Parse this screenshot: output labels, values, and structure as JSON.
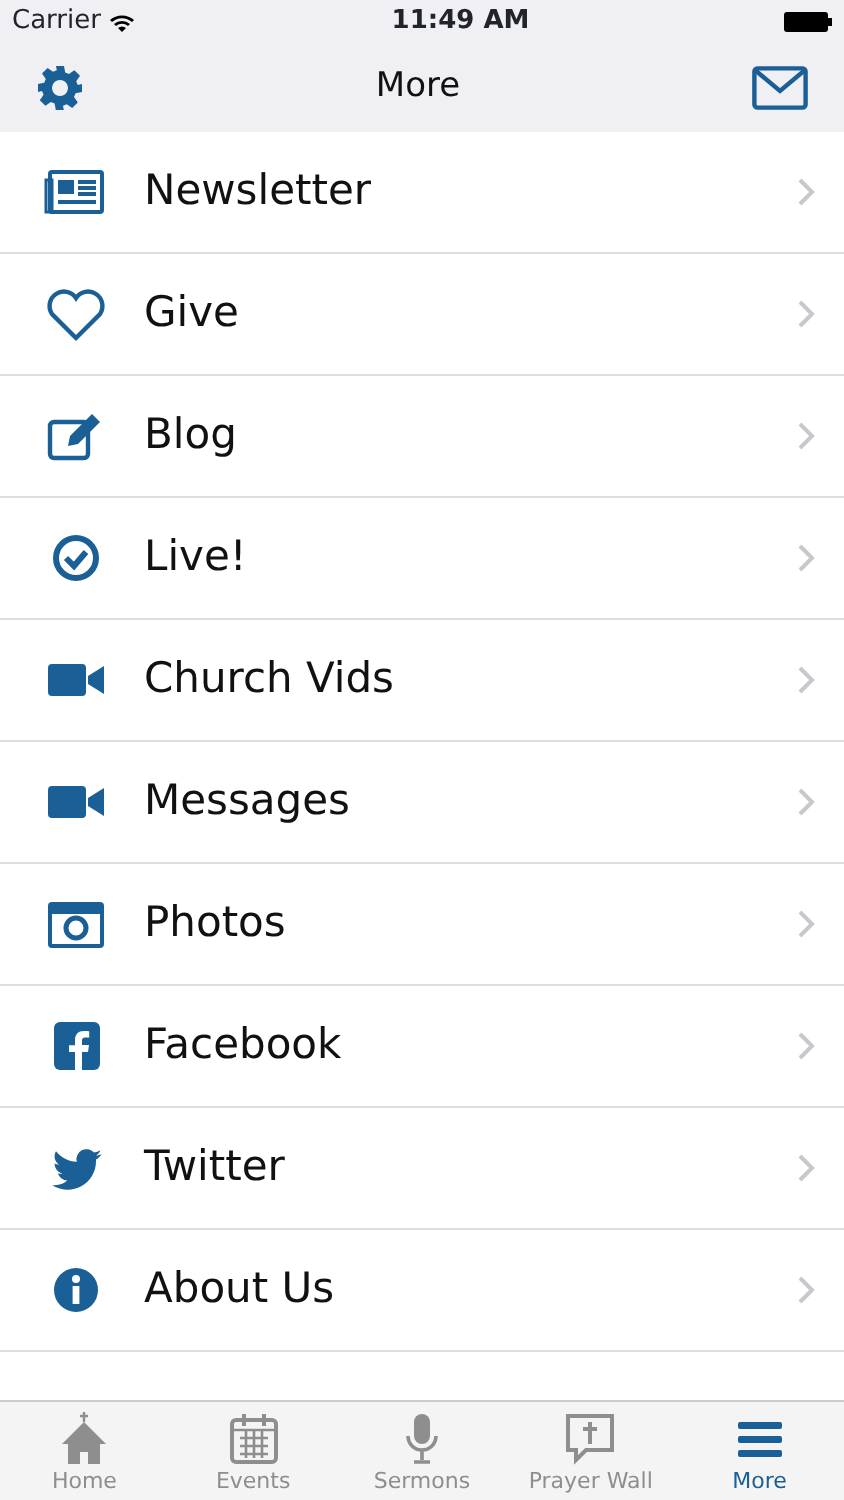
{
  "status_bar": {
    "carrier": "Carrier",
    "time": "11:49 AM"
  },
  "nav_bar": {
    "title": "More"
  },
  "items": [
    {
      "label": "Newsletter"
    },
    {
      "label": "Give"
    },
    {
      "label": "Blog"
    },
    {
      "label": "Live!"
    },
    {
      "label": "Church Vids"
    },
    {
      "label": "Messages"
    },
    {
      "label": "Photos"
    },
    {
      "label": "Facebook"
    },
    {
      "label": "Twitter"
    },
    {
      "label": "About Us"
    }
  ],
  "tab_bar": [
    {
      "label": "Home",
      "selected": false
    },
    {
      "label": "Events",
      "selected": false
    },
    {
      "label": "Sermons",
      "selected": false
    },
    {
      "label": "Prayer Wall",
      "selected": false
    },
    {
      "label": "More",
      "selected": true
    }
  ]
}
